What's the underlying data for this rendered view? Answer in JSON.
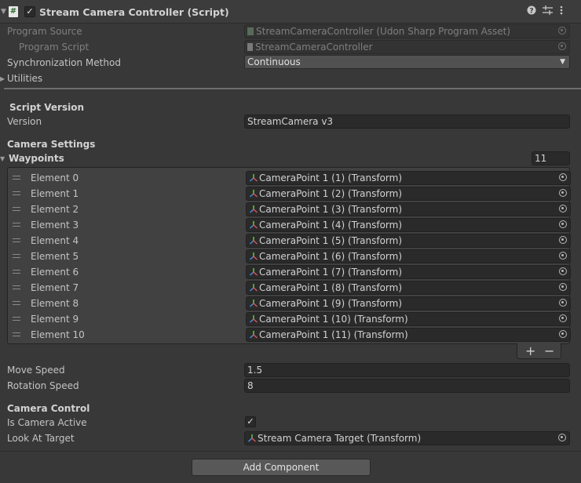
{
  "header": {
    "title": "Stream Camera Controller (Script)",
    "script_icon_glyph": "#",
    "enabled": true
  },
  "program_source": {
    "label": "Program Source",
    "value": "StreamCameraController (Udon Sharp Program Asset)"
  },
  "program_script": {
    "label": "Program Script",
    "value": "StreamCameraController"
  },
  "sync_method": {
    "label": "Synchronization Method",
    "value": "Continuous"
  },
  "utilities": {
    "label": "Utilities"
  },
  "script_version": {
    "section": "Script Version",
    "label": "Version",
    "value": "StreamCamera v3"
  },
  "camera_settings": {
    "section": "Camera Settings",
    "waypoints_label": "Waypoints",
    "waypoints_count": "11",
    "elements": [
      {
        "label": "Element 0",
        "value": "CameraPoint 1 (1) (Transform)"
      },
      {
        "label": "Element 1",
        "value": "CameraPoint 1 (2) (Transform)"
      },
      {
        "label": "Element 2",
        "value": "CameraPoint 1 (3) (Transform)"
      },
      {
        "label": "Element 3",
        "value": "CameraPoint 1 (4) (Transform)"
      },
      {
        "label": "Element 4",
        "value": "CameraPoint 1 (5) (Transform)"
      },
      {
        "label": "Element 5",
        "value": "CameraPoint 1 (6) (Transform)"
      },
      {
        "label": "Element 6",
        "value": "CameraPoint 1 (7) (Transform)"
      },
      {
        "label": "Element 7",
        "value": "CameraPoint 1 (8) (Transform)"
      },
      {
        "label": "Element 8",
        "value": "CameraPoint 1 (9) (Transform)"
      },
      {
        "label": "Element 9",
        "value": "CameraPoint 1 (10) (Transform)"
      },
      {
        "label": "Element 10",
        "value": "CameraPoint 1 (11) (Transform)"
      }
    ],
    "add_glyph": "+",
    "remove_glyph": "−",
    "move_speed": {
      "label": "Move Speed",
      "value": "1.5"
    },
    "rotation_speed": {
      "label": "Rotation Speed",
      "value": "8"
    }
  },
  "camera_control": {
    "section": "Camera Control",
    "active_label": "Is Camera Active",
    "active": true,
    "look_label": "Look At Target",
    "look_value": "Stream Camera Target (Transform)"
  },
  "add_component": "Add Component",
  "icons": {
    "script": "csharp-script-icon",
    "help": "help-icon",
    "presets": "presets-icon",
    "menu": "kebab-menu-icon",
    "transform": "transform-icon",
    "object_picker": "object-picker-icon",
    "dropdown": "dropdown-arrow-icon",
    "foldout": "foldout-arrow-icon"
  },
  "colors": {
    "background": "#383838",
    "field": "#2a2a2a",
    "text": "#c4c4c4"
  }
}
